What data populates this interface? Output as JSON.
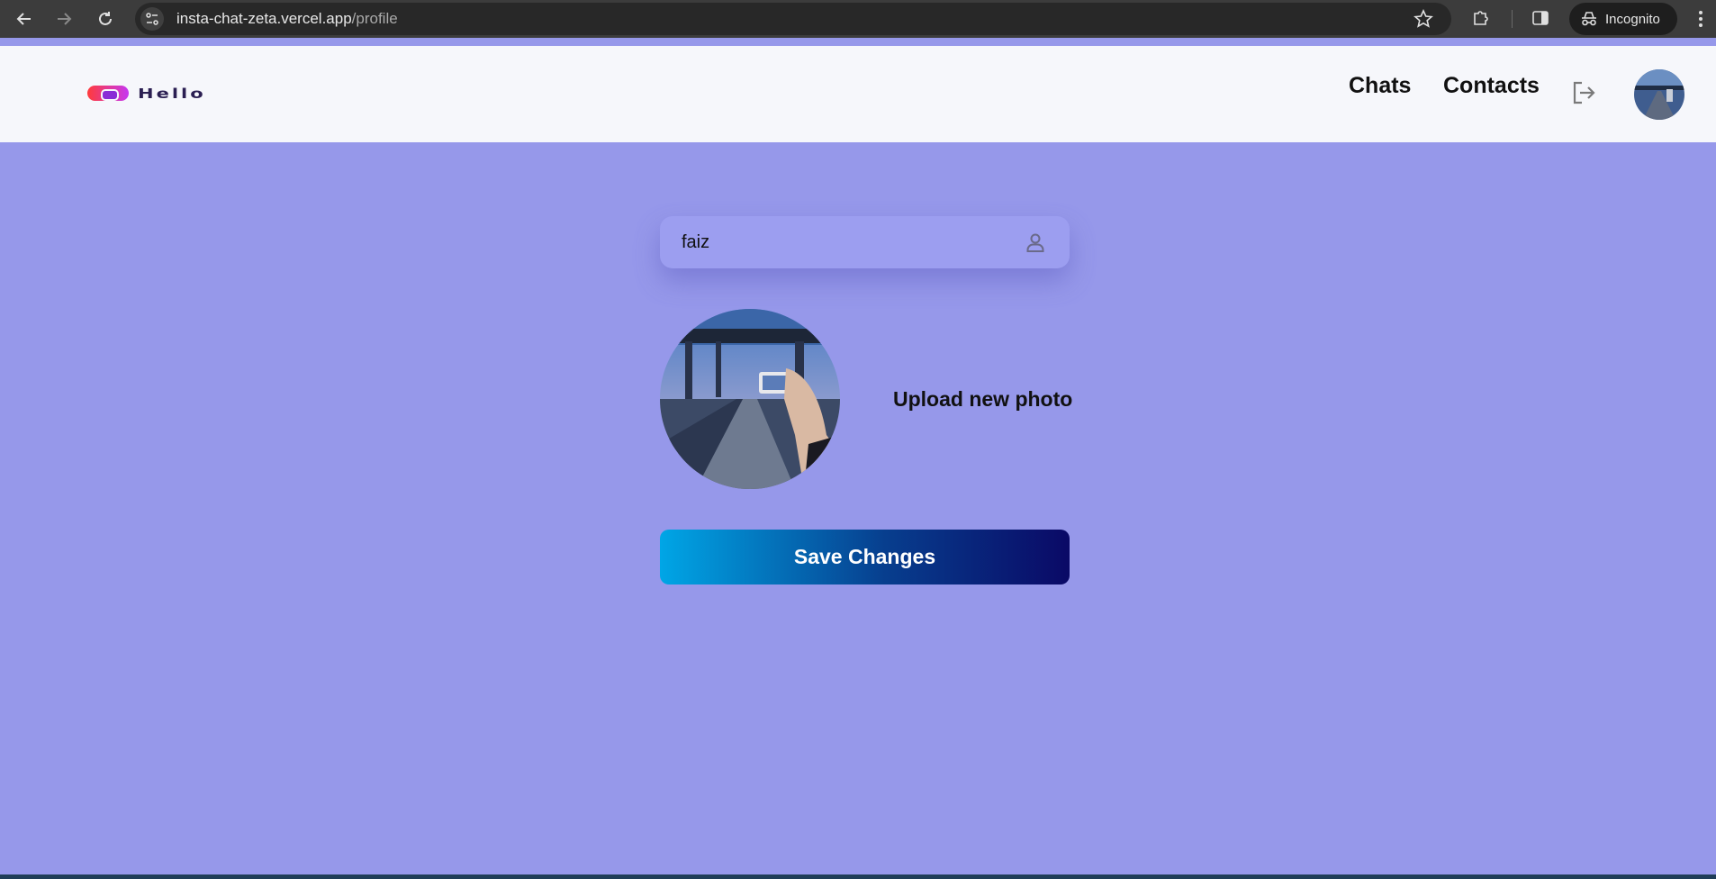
{
  "browser": {
    "url_host": "insta-chat-zeta.vercel.app",
    "url_path": "/profile",
    "mode_label": "Incognito",
    "icons": [
      "back-arrow-icon",
      "forward-arrow-icon",
      "reload-icon",
      "site-info-icon",
      "star-icon",
      "extensions-icon",
      "side-panel-icon",
      "incognito-icon",
      "more-icon"
    ]
  },
  "header": {
    "logo_text": "Hello",
    "nav": {
      "chats": "Chats",
      "contacts": "Contacts"
    },
    "icons": [
      "logout-icon",
      "user-avatar"
    ]
  },
  "profile": {
    "name_value": "faiz",
    "name_icon": "user-icon",
    "upload_label": "Upload new photo",
    "save_label": "Save Changes"
  },
  "colors": {
    "page_background": "#9698ea",
    "header_background": "#f6f7fb",
    "button_gradient_start": "#00a6e6",
    "button_gradient_end": "#0a0966"
  }
}
